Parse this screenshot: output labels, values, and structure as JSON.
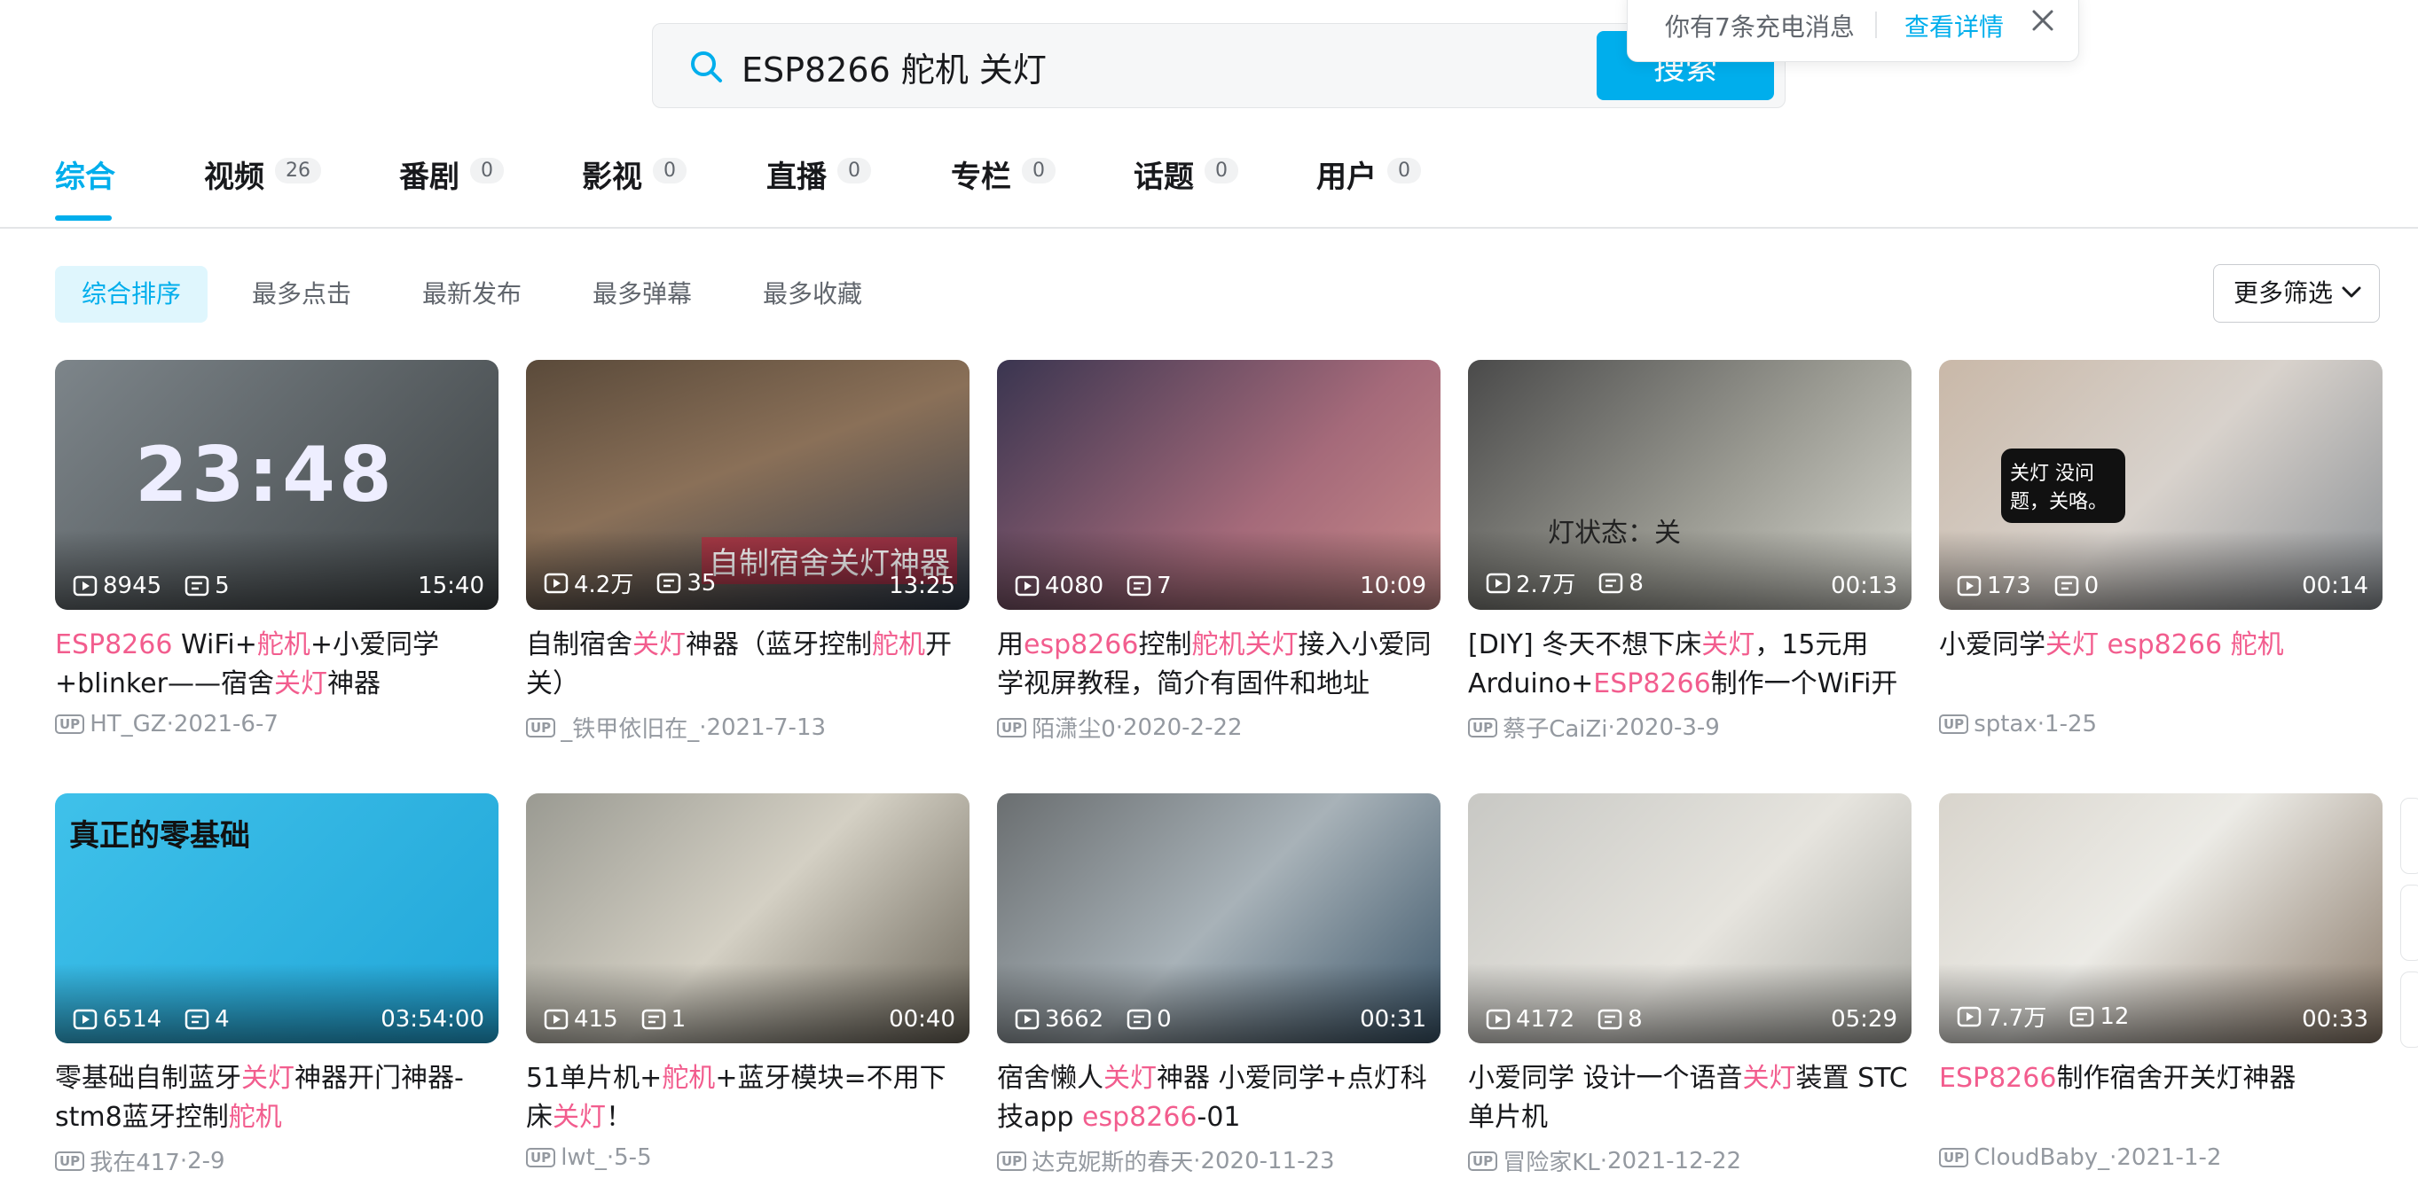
{
  "search": {
    "query": "ESP8266 舵机 关灯",
    "button": "搜索"
  },
  "toast": {
    "message": "你有7条充电消息",
    "link": "查看详情"
  },
  "tabs": [
    {
      "label": "综合",
      "count": ""
    },
    {
      "label": "视频",
      "count": "26"
    },
    {
      "label": "番剧",
      "count": "0"
    },
    {
      "label": "影视",
      "count": "0"
    },
    {
      "label": "直播",
      "count": "0"
    },
    {
      "label": "专栏",
      "count": "0"
    },
    {
      "label": "话题",
      "count": "0"
    },
    {
      "label": "用户",
      "count": "0"
    }
  ],
  "sorts": [
    "综合排序",
    "最多点击",
    "最新发布",
    "最多弹幕",
    "最多收藏"
  ],
  "more_filter": "更多筛选",
  "accent": "#00aeec",
  "highlight": "#f25d8e",
  "videos": [
    {
      "views": "8945",
      "danmaku": "5",
      "duration": "15:40",
      "title": [
        {
          "t": "ESP8266",
          "h": true
        },
        {
          "t": " WiFi+",
          "h": false
        },
        {
          "t": "舵机",
          "h": true
        },
        {
          "t": "+小爱同学+blinker——宿舍",
          "h": false
        },
        {
          "t": "关灯",
          "h": true
        },
        {
          "t": "神器",
          "h": false
        }
      ],
      "author": "HT_GZ",
      "date": "2021-6-7",
      "thumb": {
        "bg": "linear-gradient(135deg,#7d858a,#3d4244)",
        "overlay": "23:48"
      }
    },
    {
      "views": "4.2万",
      "danmaku": "35",
      "duration": "13:25",
      "title": [
        {
          "t": "自制宿舍",
          "h": false
        },
        {
          "t": "关灯",
          "h": true
        },
        {
          "t": "神器（蓝牙控制",
          "h": false
        },
        {
          "t": "舵机",
          "h": true
        },
        {
          "t": "开关）",
          "h": false
        }
      ],
      "author": "_铁甲依旧在_",
      "date": "2021-7-13",
      "thumb": {
        "bg": "linear-gradient(160deg,#5a4a3a,#8a7058 45%,#2f3a4a)",
        "overlay": "自制宿舍关灯神器"
      }
    },
    {
      "views": "4080",
      "danmaku": "7",
      "duration": "10:09",
      "title": [
        {
          "t": "用",
          "h": false
        },
        {
          "t": "esp8266",
          "h": true
        },
        {
          "t": "控制",
          "h": false
        },
        {
          "t": "舵机",
          "h": true
        },
        {
          "t": "关灯",
          "h": true
        },
        {
          "t": "接入小爱同学视屏教程，简介有固件和地址",
          "h": false
        }
      ],
      "author": "陌潇尘0",
      "date": "2020-2-22",
      "thumb": {
        "bg": "linear-gradient(135deg,#3a3550,#a56a7a 60%,#c98a8a)",
        "overlay": ""
      }
    },
    {
      "views": "2.7万",
      "danmaku": "8",
      "duration": "00:13",
      "title": [
        {
          "t": "[DIY] 冬天不想下床",
          "h": false
        },
        {
          "t": "关灯",
          "h": true
        },
        {
          "t": "，15元用Arduino+",
          "h": false
        },
        {
          "t": "ESP8266",
          "h": true
        },
        {
          "t": "制作一个WiFi开关吧",
          "h": false
        }
      ],
      "author": "蔡子CaiZi",
      "date": "2020-3-9",
      "thumb": {
        "bg": "linear-gradient(135deg,#4a4a4a,#9a9a92 55%,#d8d8d0)",
        "overlay": "灯状态：关"
      }
    },
    {
      "views": "173",
      "danmaku": "0",
      "duration": "00:14",
      "title": [
        {
          "t": "小爱同学",
          "h": false
        },
        {
          "t": "关灯",
          "h": true
        },
        {
          "t": " ",
          "h": false
        },
        {
          "t": "esp8266",
          "h": true
        },
        {
          "t": " ",
          "h": false
        },
        {
          "t": "舵机",
          "h": true
        }
      ],
      "author": "sptax",
      "date": "1-25",
      "thumb": {
        "bg": "linear-gradient(135deg,#c9b8a8,#d8d2cc 50%,#8a8f94)",
        "overlay": "关灯 没问题，关咯。"
      }
    },
    {
      "views": "6514",
      "danmaku": "4",
      "duration": "03:54:00",
      "title": [
        {
          "t": "零基础自制蓝牙",
          "h": false
        },
        {
          "t": "关灯",
          "h": true
        },
        {
          "t": "神器开门神器-stm8蓝牙控制",
          "h": false
        },
        {
          "t": "舵机",
          "h": true
        }
      ],
      "author": "我在417",
      "date": "2-9",
      "thumb": {
        "bg": "linear-gradient(135deg,#3fc1ea,#21a6d8)",
        "overlay": "真正的零基础"
      }
    },
    {
      "views": "415",
      "danmaku": "1",
      "duration": "00:40",
      "title": [
        {
          "t": "51单片机+",
          "h": false
        },
        {
          "t": "舵机",
          "h": true
        },
        {
          "t": "+蓝牙模块=不用下床",
          "h": false
        },
        {
          "t": "关灯",
          "h": true
        },
        {
          "t": "！",
          "h": false
        }
      ],
      "author": "lwt_",
      "date": "5-5",
      "thumb": {
        "bg": "linear-gradient(135deg,#9a9a92,#d4d0c4 50%,#6a6458)",
        "overlay": ""
      }
    },
    {
      "views": "3662",
      "danmaku": "0",
      "duration": "00:31",
      "title": [
        {
          "t": "宿舍懒人",
          "h": false
        },
        {
          "t": "关灯",
          "h": true
        },
        {
          "t": "神器 小爱同学+点灯科技app ",
          "h": false
        },
        {
          "t": "esp8266",
          "h": true
        },
        {
          "t": "-01",
          "h": false
        }
      ],
      "author": "达克妮斯的春天",
      "date": "2020-11-23",
      "thumb": {
        "bg": "linear-gradient(135deg,#6a6e70,#a8b2b8 50%,#3a5468)",
        "overlay": ""
      }
    },
    {
      "views": "4172",
      "danmaku": "8",
      "duration": "05:29",
      "title": [
        {
          "t": "小爱同学 设计一个语音",
          "h": false
        },
        {
          "t": "关灯",
          "h": true
        },
        {
          "t": "装置 STC单片机",
          "h": false
        }
      ],
      "author": "冒险家KL",
      "date": "2021-12-22",
      "thumb": {
        "bg": "linear-gradient(135deg,#c8c8c4,#e6e4de 55%,#a8a8a2)",
        "overlay": ""
      }
    },
    {
      "views": "7.7万",
      "danmaku": "12",
      "duration": "00:33",
      "title": [
        {
          "t": "ESP8266",
          "h": true
        },
        {
          "t": "制作宿舍开关灯神器",
          "h": false
        }
      ],
      "author": "CloudBaby_",
      "date": "2021-1-2",
      "thumb": {
        "bg": "linear-gradient(135deg,#d8d4cc,#ecebe6 45%,#8a7a6a)",
        "overlay": ""
      }
    }
  ]
}
